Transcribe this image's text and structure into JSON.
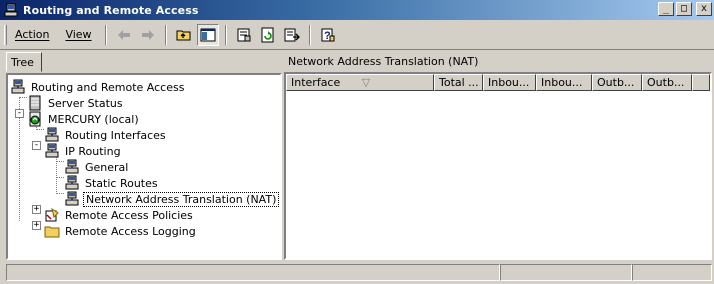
{
  "window": {
    "title": "Routing and Remote Access",
    "icon": "rras-server-icon",
    "controls": [
      "minimize",
      "maximize",
      "close"
    ]
  },
  "menu": [
    {
      "label": "Action",
      "accel": "A"
    },
    {
      "label": "View",
      "accel": "V"
    }
  ],
  "toolbar_icons": [
    "back-arrow-icon",
    "forward-arrow-icon",
    "up-folder-icon",
    "show-hide-tree-icon",
    "properties-icon",
    "refresh-icon",
    "export-list-icon",
    "help-icon"
  ],
  "left_panel": {
    "tab_label": "Tree",
    "tree": [
      {
        "label": "Routing and Remote Access",
        "icon": "rras-root-icon",
        "selected": false
      },
      {
        "label": "Server Status",
        "icon": "server-status-icon",
        "selected": false
      },
      {
        "label": "MERCURY (local)",
        "icon": "server-green-icon",
        "expander": "-",
        "selected": false
      },
      {
        "label": "Routing Interfaces",
        "icon": "interfaces-icon",
        "selected": false
      },
      {
        "label": "IP Routing",
        "icon": "ip-routing-icon",
        "expander": "-",
        "selected": false
      },
      {
        "label": "General",
        "icon": "routing-node-icon",
        "selected": false
      },
      {
        "label": "Static Routes",
        "icon": "routing-node-icon",
        "selected": false
      },
      {
        "label": "Network Address Translation (NAT)",
        "icon": "routing-node-icon",
        "selected": true
      },
      {
        "label": "Remote Access Policies",
        "icon": "policies-icon",
        "expander": "+",
        "selected": false
      },
      {
        "label": "Remote Access Logging",
        "icon": "folder-icon",
        "expander": "+",
        "selected": false
      }
    ]
  },
  "right_panel": {
    "header": "Network Address Translation (NAT)",
    "columns": [
      {
        "label": "Interface",
        "sort_indicator": "▽"
      },
      {
        "label": "Total ..."
      },
      {
        "label": "Inbou..."
      },
      {
        "label": "Inbou..."
      },
      {
        "label": "Outb..."
      },
      {
        "label": "Outb..."
      }
    ],
    "rows": []
  },
  "statusbar": {
    "panels": [
      "",
      "",
      ""
    ]
  },
  "colors": {
    "title_start": "#0a246a",
    "title_end": "#a6caf0",
    "face": "#d4d0c8",
    "pane_bg": "#ffffff"
  }
}
